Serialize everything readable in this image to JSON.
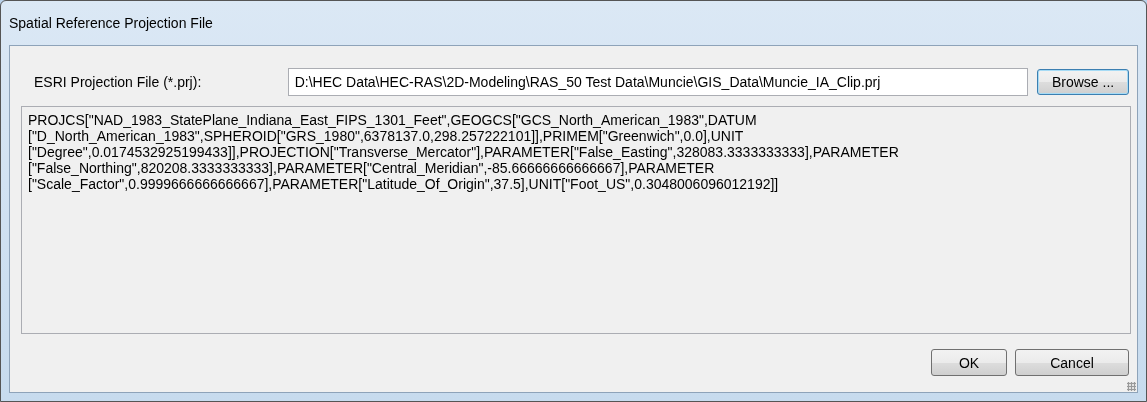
{
  "window": {
    "title": "Spatial Reference Projection File"
  },
  "file_field": {
    "label": "ESRI Projection File (*.prj):",
    "value": "D:\\HEC Data\\HEC-RAS\\2D-Modeling\\RAS_50 Test Data\\Muncie\\GIS_Data\\Muncie_IA_Clip.prj"
  },
  "browse_button": "Browse ...",
  "projection_text": [
    "PROJCS[\"NAD_1983_StatePlane_Indiana_East_FIPS_1301_Feet\",GEOGCS[\"GCS_North_American_1983\",DATUM",
    "[\"D_North_American_1983\",SPHEROID[\"GRS_1980\",6378137.0,298.257222101]],PRIMEM[\"Greenwich\",0.0],UNIT",
    "[\"Degree\",0.0174532925199433]],PROJECTION[\"Transverse_Mercator\"],PARAMETER[\"False_Easting\",328083.3333333333],PARAMETER",
    "[\"False_Northing\",820208.3333333333],PARAMETER[\"Central_Meridian\",-85.66666666666667],PARAMETER",
    "[\"Scale_Factor\",0.9999666666666667],PARAMETER[\"Latitude_Of_Origin\",37.5],UNIT[\"Foot_US\",0.3048006096012192]]"
  ],
  "buttons": [
    "OK",
    "Cancel"
  ]
}
